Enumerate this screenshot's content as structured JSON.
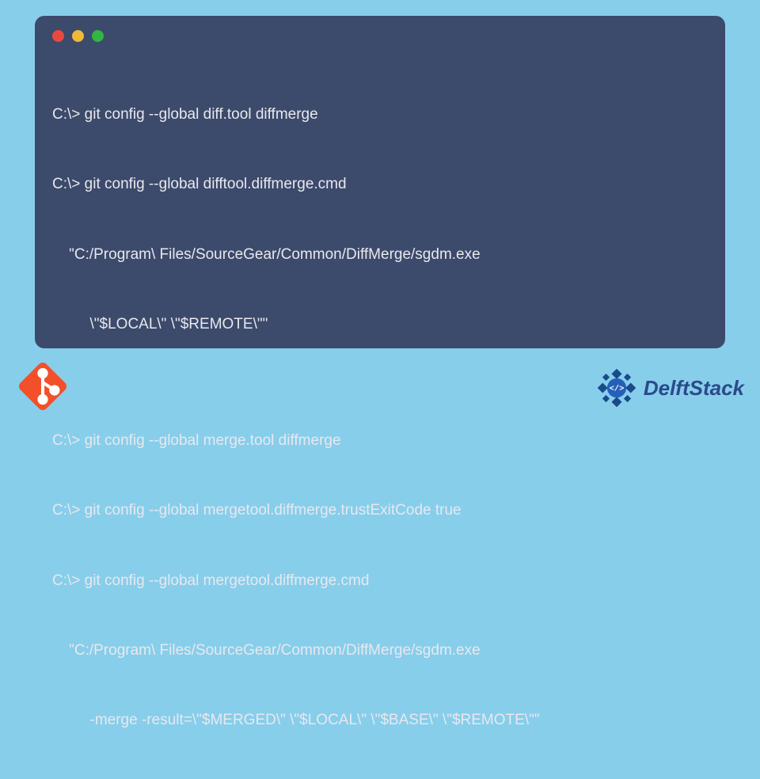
{
  "terminal": {
    "lines": [
      "C:\\> git config --global diff.tool diffmerge",
      "C:\\> git config --global difftool.diffmerge.cmd",
      "    \"C:/Program\\ Files/SourceGear/Common/DiffMerge/sgdm.exe",
      "         \\\"$LOCAL\\\" \\\"$REMOTE\\\"\"",
      "",
      "C:\\> git config --global merge.tool diffmerge",
      "C:\\> git config --global mergetool.diffmerge.trustExitCode true",
      "C:\\> git config --global mergetool.diffmerge.cmd",
      "    \"C:/Program\\ Files/SourceGear/Common/DiffMerge/sgdm.exe",
      "         -merge -result=\\\"$MERGED\\\" \\\"$LOCAL\\\" \\\"$BASE\\\" \\\"$REMOTE\\\"\""
    ]
  },
  "branding": {
    "name": "DelftStack"
  },
  "colors": {
    "bg": "#87ceeb",
    "terminal": "#3c4a6b",
    "text": "#e8e8ee",
    "git": "#f34f29",
    "brand": "#2a4a8a"
  }
}
